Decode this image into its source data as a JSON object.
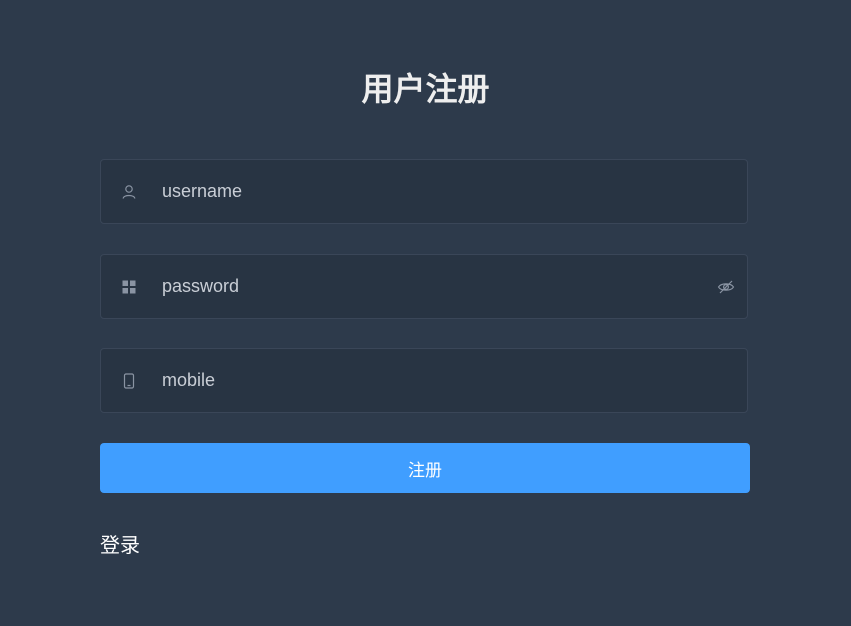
{
  "form": {
    "title": "用户注册",
    "fields": [
      {
        "placeholder": "username",
        "value": "",
        "icon": "user-icon"
      },
      {
        "placeholder": "password",
        "value": "",
        "icon": "password-icon",
        "trailing_icon": "eye-hidden-icon"
      },
      {
        "placeholder": "mobile",
        "value": "",
        "icon": "mobile-icon"
      }
    ],
    "submit_label": "注册",
    "login_link": "登录"
  },
  "colors": {
    "background": "#2d3a4b",
    "input_background": "#283443",
    "accent": "#409eff",
    "text": "#ffffff"
  }
}
